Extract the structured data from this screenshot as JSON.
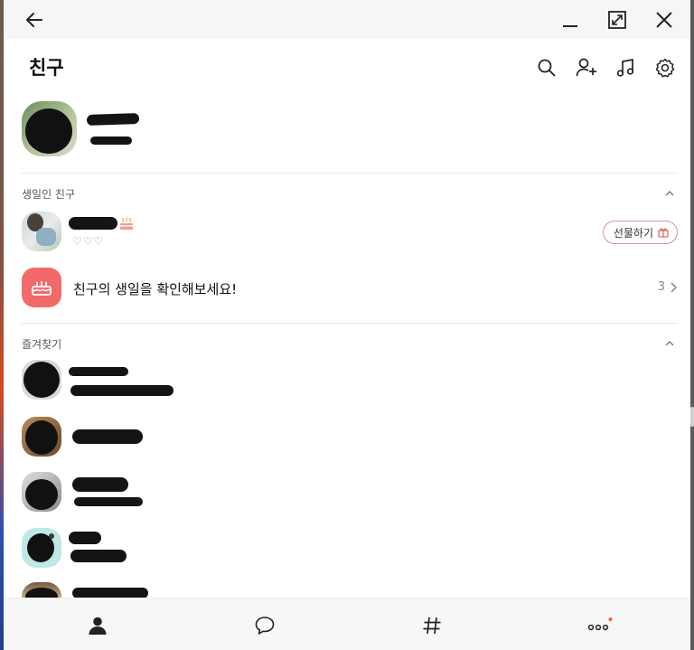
{
  "window": {
    "back_icon": "arrow-left-icon",
    "minimize_icon": "minimize-icon",
    "maximize_icon": "maximize-icon",
    "close_icon": "close-icon"
  },
  "header": {
    "title": "친구",
    "icons": [
      "search-icon",
      "add-friend-icon",
      "music-icon",
      "settings-icon"
    ]
  },
  "sections": {
    "birthday_title": "생일인 친구",
    "favorites_title": "즐겨찾기"
  },
  "birthday_friend": {
    "status": "♡♡♡",
    "gift_label": "선물하기"
  },
  "birthday_check": {
    "text": "친구의 생일을 확인해보세요!",
    "count": "3"
  },
  "bottom_nav": {
    "items": [
      "friends-icon",
      "chat-icon",
      "hashtag-icon",
      "more-icon"
    ],
    "accent": "#f0642d"
  },
  "colors": {
    "birthday_accent": "#f06a6a",
    "gift_border": "#c99a9e"
  }
}
